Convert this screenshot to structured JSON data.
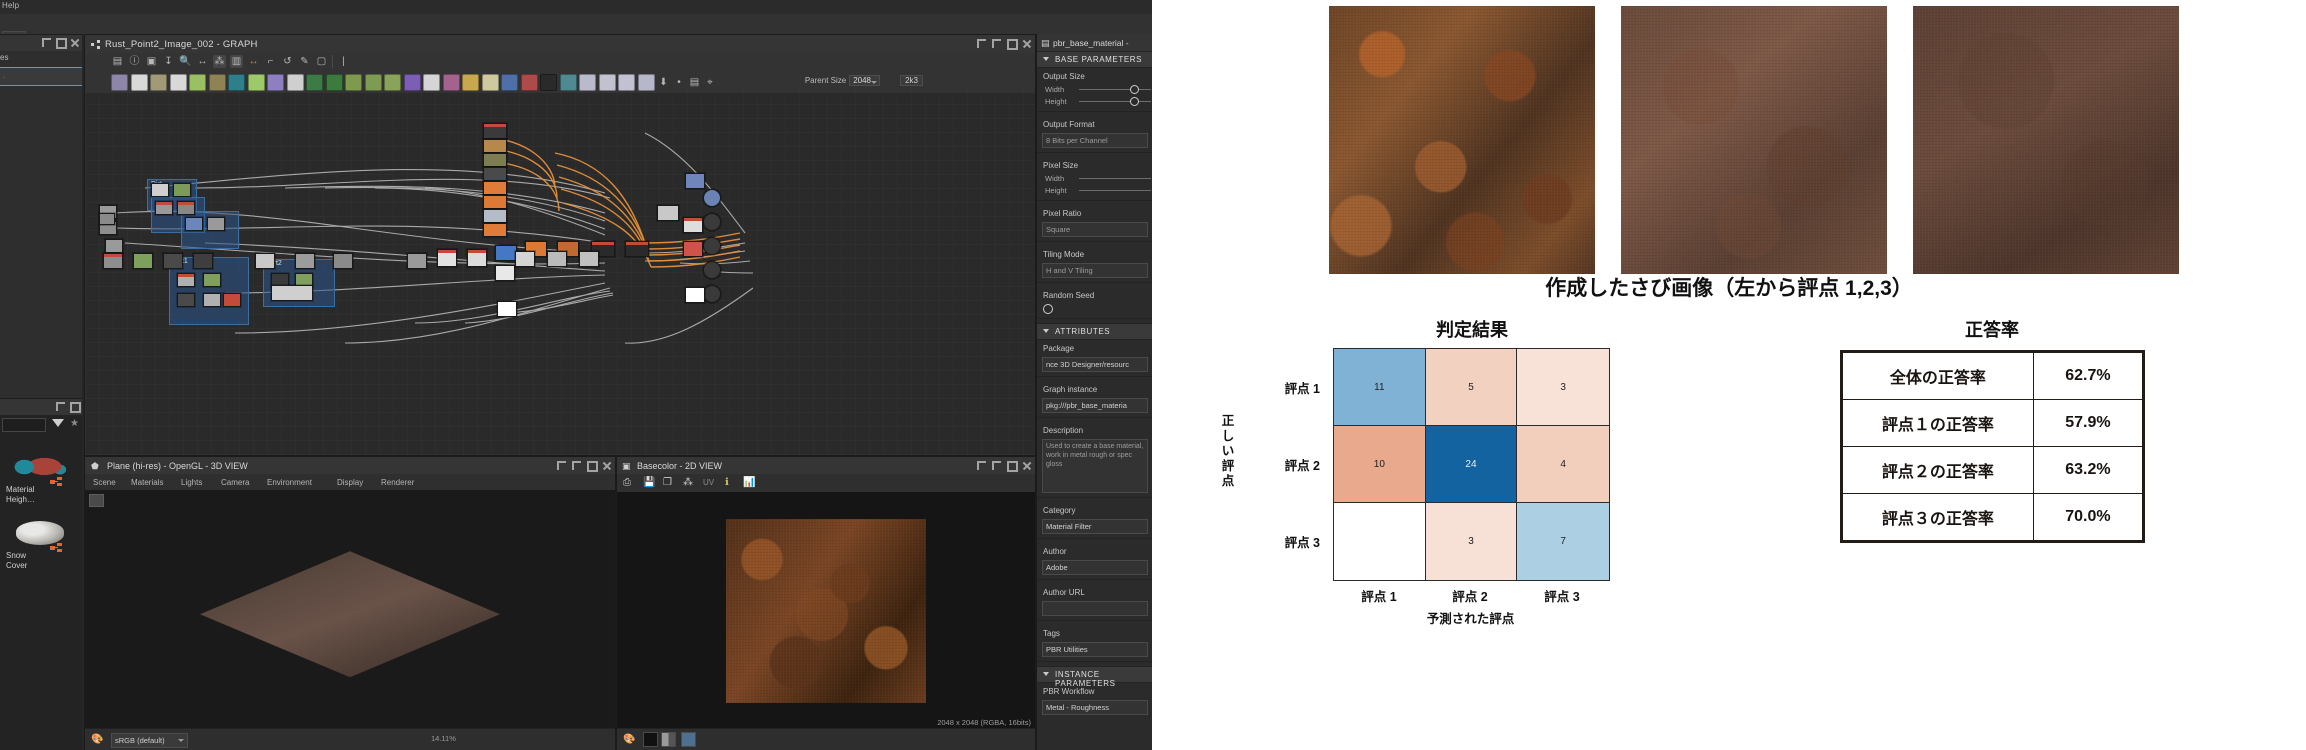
{
  "app": {
    "menu": {
      "help": "Help"
    },
    "explorer": {
      "tab_label": "es",
      "selected_item": "."
    },
    "library": {
      "items": [
        {
          "label": "Material\nHeigh…",
          "icon": "material-thumbnail"
        },
        {
          "label": "Snow\nCover",
          "icon": "snow-thumbnail"
        }
      ]
    },
    "graph": {
      "title": "Rust_Point2_Image_002 - GRAPH",
      "parent_size_label": "Parent Size",
      "parent_size_value": "2048",
      "resolution": "2k3",
      "toolbar_primary": [
        "new-graph-icon",
        "info-icon",
        "camera-icon",
        "cursor-icon",
        "zoom-icon",
        "pan-icon",
        "graph-icon",
        "grid-icon",
        "link-icon",
        "path-icon",
        "refresh-icon",
        "edit-icon",
        "node-icon"
      ],
      "frames": [
        {
          "label": "Dirt1"
        },
        {
          "label": "Dirt2"
        }
      ]
    },
    "view3d": {
      "title": "Plane (hi-res) - OpenGL - 3D VIEW",
      "menu": [
        "Scene",
        "Materials",
        "Lights",
        "Camera",
        "Environment",
        "Display",
        "Renderer"
      ],
      "colorspace": "sRGB (default)"
    },
    "view2d": {
      "title": "Basecolor - 2D VIEW",
      "uv_label": "UV",
      "info_text": "2048 x 2048 (RGBA, 16bits)",
      "zoom": "14.11%"
    },
    "props": {
      "title": "pbr_base_material -",
      "sections": {
        "base_parameters": "BASE PARAMETERS",
        "attributes": "ATTRIBUTES",
        "instance_parameters": "INSTANCE PARAMETERS"
      },
      "fields": [
        {
          "label": "Output Size",
          "sub": [
            "Width",
            "Height"
          ],
          "type": "sliders"
        },
        {
          "label": "Output Format",
          "value": "8 Bits per Channel",
          "type": "combo"
        },
        {
          "label": "Pixel Size",
          "sub": [
            "Width",
            "Height"
          ],
          "type": "sliders"
        },
        {
          "label": "Pixel Ratio",
          "value": "Square",
          "type": "combo"
        },
        {
          "label": "Tiling Mode",
          "value": "H and V Tiling",
          "type": "combo"
        },
        {
          "label": "Random Seed",
          "value": "",
          "type": "knob"
        }
      ],
      "attributes": [
        {
          "label": "Package",
          "value": "nce 3D Designer/resourc"
        },
        {
          "label": "Graph instance",
          "value": "pkg:///pbr_base_materia"
        },
        {
          "label": "Description",
          "value": "Used to create a base material, work in metal rough or spec gloss"
        },
        {
          "label": "Category",
          "value": "Material Filter"
        },
        {
          "label": "Author",
          "value": "Adobe"
        },
        {
          "label": "Author URL",
          "value": ""
        },
        {
          "label": "Tags",
          "value": "PBR Utilities"
        }
      ],
      "instance": [
        {
          "label": "PBR Workflow",
          "value": "Metal - Roughness"
        }
      ]
    }
  },
  "slide": {
    "rust_caption": "作成したさび画像（左から評点 1,2,3）",
    "rust_images": [
      "rust-image-score-1",
      "rust-image-score-2",
      "rust-image-score-3"
    ],
    "accuracy": {
      "title": "正答率",
      "rows": [
        {
          "label": "全体の正答率",
          "value": "62.7%"
        },
        {
          "label": "評点１の正答率",
          "value": "57.9%"
        },
        {
          "label": "評点２の正答率",
          "value": "63.2%"
        },
        {
          "label": "評点３の正答率",
          "value": "70.0%"
        }
      ]
    }
  },
  "chart_data": {
    "type": "heatmap",
    "title": "判定結果",
    "xlabel": "予測された評点",
    "ylabel": "正しい評点",
    "x_categories": [
      "評点 1",
      "評点 2",
      "評点 3"
    ],
    "y_categories": [
      "評点 1",
      "評点 2",
      "評点 3"
    ],
    "matrix": [
      [
        11,
        5,
        3
      ],
      [
        10,
        24,
        4
      ],
      [
        0,
        3,
        7
      ]
    ],
    "cell_colors": [
      [
        "#7fb2d4",
        "#f3d1c1",
        "#f8e2d7"
      ],
      [
        "#e8a98d",
        "#1363a0",
        "#f2cfbd"
      ],
      [
        "#ffffff",
        "#f7e0d5",
        "#adcfe4"
      ]
    ],
    "cell_text_colors": [
      [
        "#222222",
        "#222222",
        "#222222"
      ],
      [
        "#222222",
        "#e8f1f8",
        "#222222"
      ],
      [
        "#222222",
        "#222222",
        "#222222"
      ]
    ],
    "show_empty_zero": true,
    "colormap": "coolwarm-diverging",
    "grid": true,
    "legend": "none"
  }
}
